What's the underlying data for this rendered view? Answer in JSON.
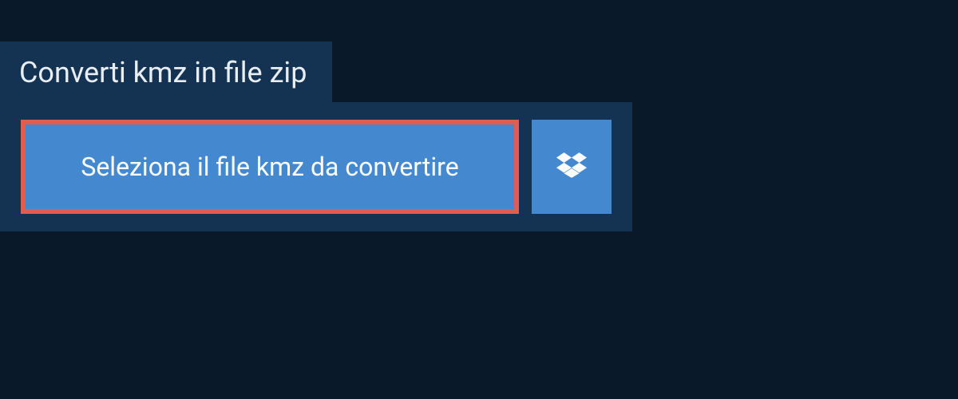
{
  "tab": {
    "title": "Converti kmz in file zip"
  },
  "actions": {
    "select_file_label": "Seleziona il file kmz da convertire"
  }
}
